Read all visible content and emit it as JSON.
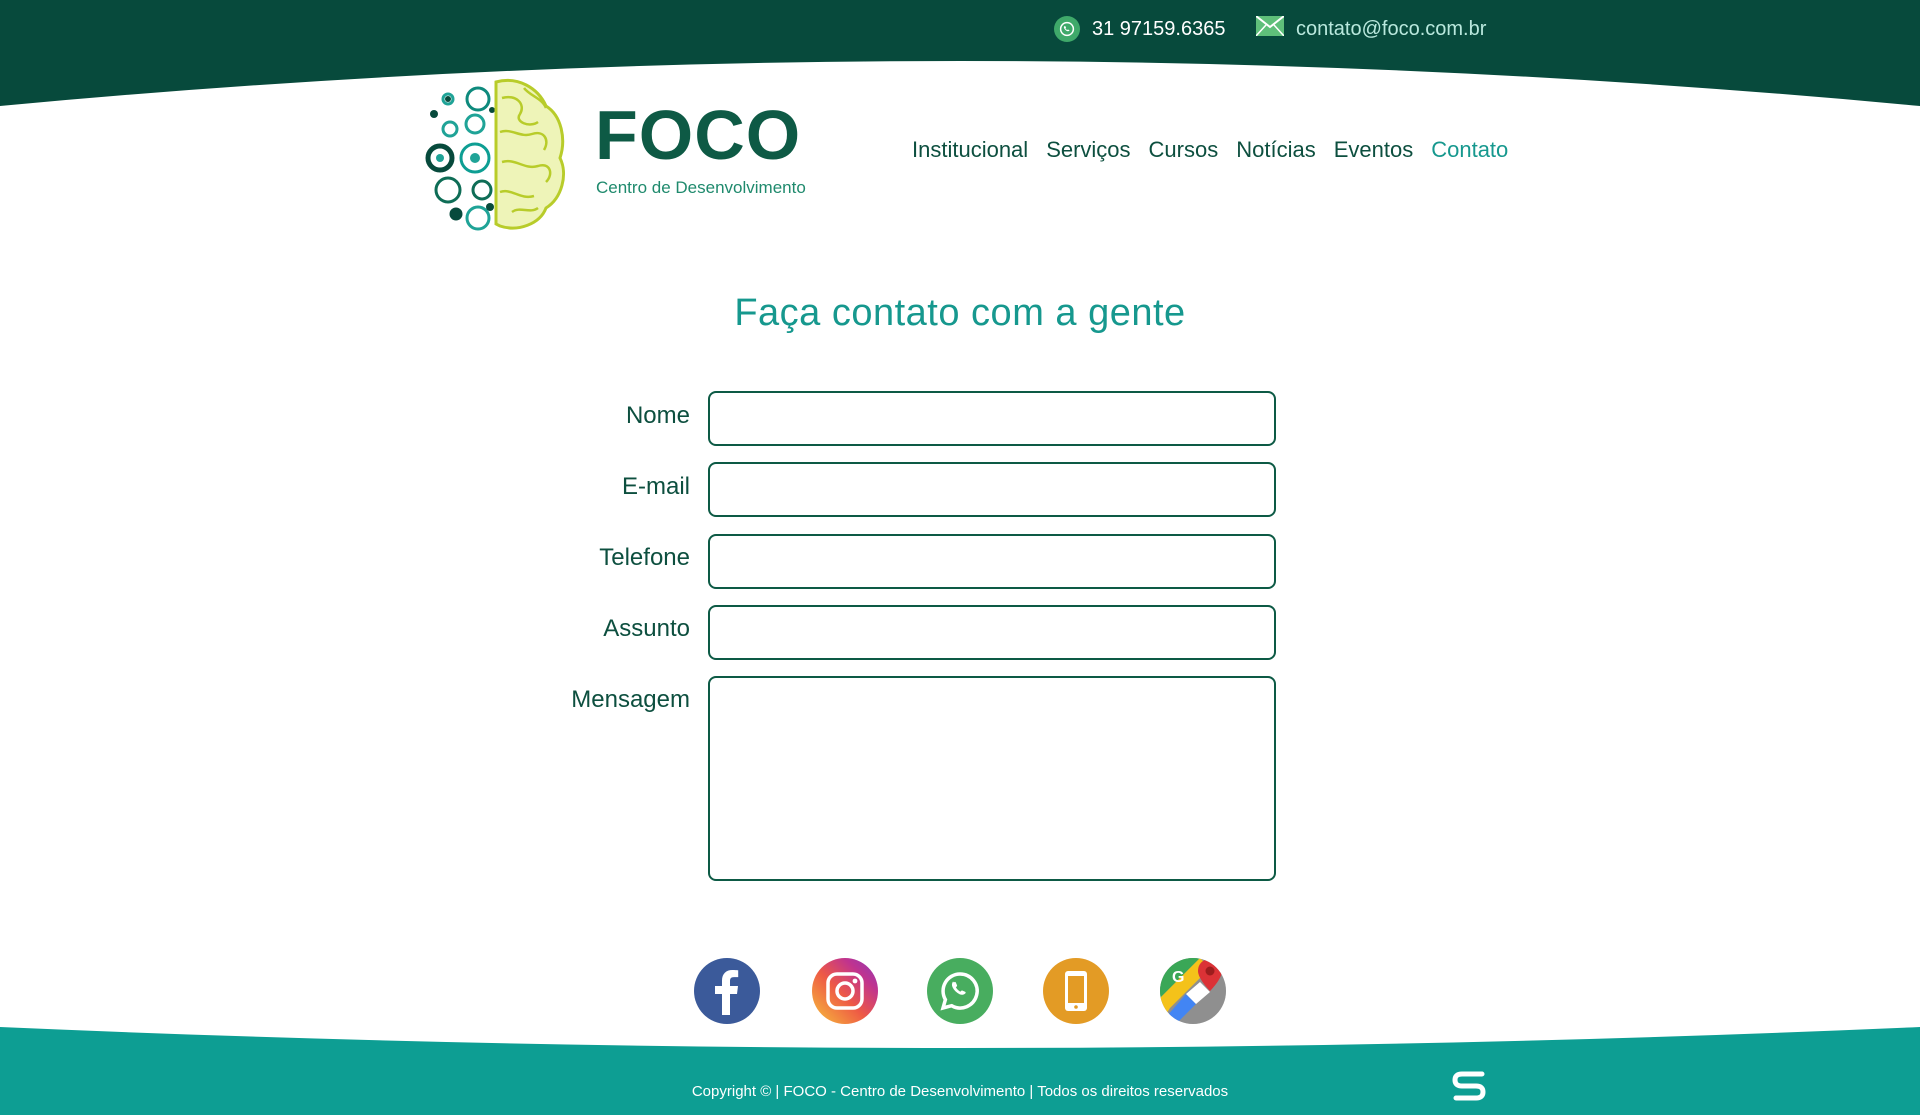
{
  "topbar": {
    "phone": "31 97159.6365",
    "email": "contato@foco.com.br",
    "phone_icon": "whatsapp-icon",
    "email_icon": "envelope-icon"
  },
  "logo": {
    "name": "FOCO",
    "tagline": "Centro de Desenvolvimento"
  },
  "nav": {
    "items": [
      {
        "label": "Institucional"
      },
      {
        "label": "Serviços"
      },
      {
        "label": "Cursos"
      },
      {
        "label": "Notícias"
      },
      {
        "label": "Eventos"
      },
      {
        "label": "Contato",
        "active": true
      }
    ]
  },
  "page": {
    "heading": "Faça contato com a gente"
  },
  "form": {
    "nome_label": "Nome",
    "email_label": "E-mail",
    "telefone_label": "Telefone",
    "assunto_label": "Assunto",
    "mensagem_label": "Mensagem",
    "nome_value": "",
    "email_value": "",
    "telefone_value": "",
    "assunto_value": "",
    "mensagem_value": ""
  },
  "social": [
    {
      "icon": "facebook-icon"
    },
    {
      "icon": "instagram-icon"
    },
    {
      "icon": "whatsapp-icon"
    },
    {
      "icon": "phone-icon"
    },
    {
      "icon": "google-maps-icon"
    }
  ],
  "footer": {
    "copyright": "Copyright © | FOCO - Centro de Desenvolvimento | Todos os direitos reservados"
  },
  "colors": {
    "dark_green": "#074a3c",
    "teal": "#0d9e93",
    "accent_text": "#16988e",
    "facebook": "#3b5a9a",
    "whatsapp": "#48ad5f",
    "phone": "#e39b25"
  }
}
